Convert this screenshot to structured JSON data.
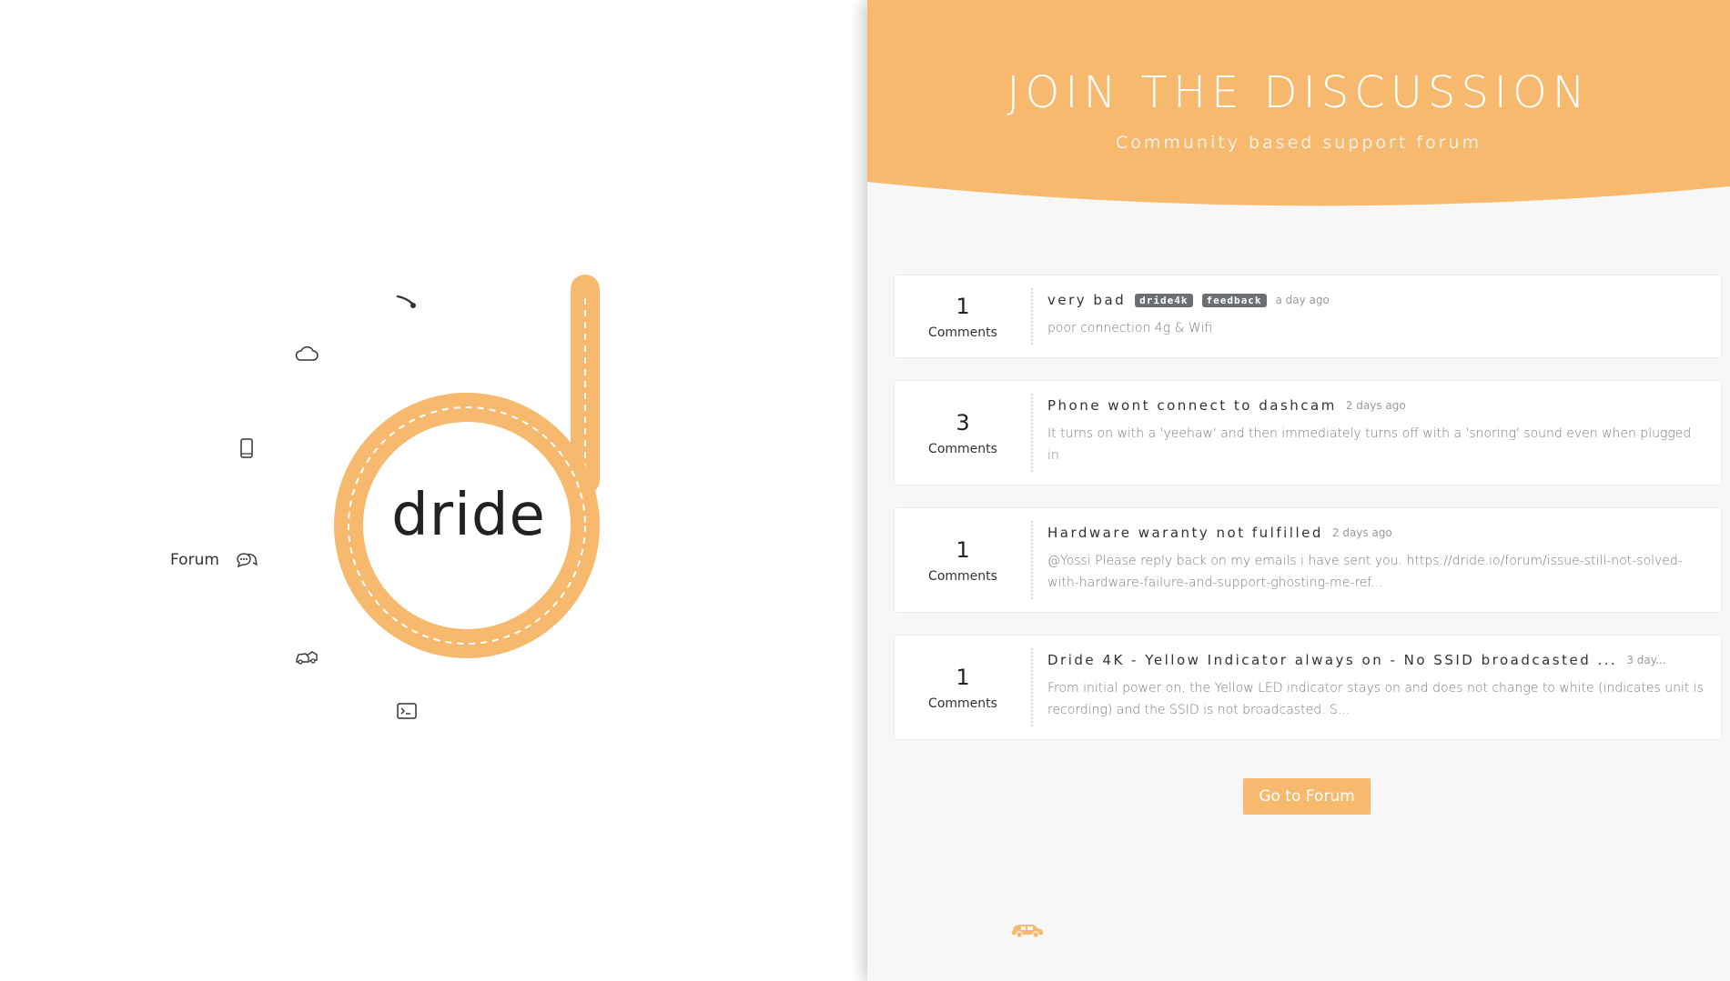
{
  "brand": {
    "name": "dride",
    "color": "#f6b96d"
  },
  "nav": {
    "items": [
      {
        "name": "dashcam-icon",
        "label": ""
      },
      {
        "name": "cloud-icon",
        "label": ""
      },
      {
        "name": "phone-icon",
        "label": ""
      },
      {
        "name": "forum-icon",
        "label": "Forum"
      },
      {
        "name": "car-crash-icon",
        "label": ""
      },
      {
        "name": "terminal-icon",
        "label": ""
      }
    ]
  },
  "hero": {
    "title": "JOIN THE DISCUSSION",
    "subtitle": "Community based support forum"
  },
  "threads": [
    {
      "count": "1",
      "count_label": "Comments",
      "title": "very bad",
      "tags": [
        "dride4k",
        "feedback"
      ],
      "time": "a day ago",
      "excerpt": "poor connection 4g & Wifi"
    },
    {
      "count": "3",
      "count_label": "Comments",
      "title": "Phone wont connect to dashcam",
      "tags": [],
      "time": "2 days ago",
      "excerpt": "It turns on with a 'yeehaw' and then immediately turns off with a 'snoring' sound even when plugged in"
    },
    {
      "count": "1",
      "count_label": "Comments",
      "title": "Hardware waranty not fulfilled",
      "tags": [],
      "time": "2 days ago",
      "excerpt": "@Yossi Please reply back on my emails i have sent you. https://dride.io/forum/issue-still-not-solved-with-hardware-failure-and-support-ghosting-me-ref..."
    },
    {
      "count": "1",
      "count_label": "Comments",
      "title": "Dride 4K - Yellow Indicator always on - No SSID broadcasted ...",
      "tags": [],
      "time": "3 day...",
      "excerpt": "From initial power on, the Yellow LED indicator stays on and does not change to white (indicates unit is recording) and the SSID is not broadcasted. S..."
    }
  ],
  "cta": {
    "label": "Go to Forum"
  },
  "footer": {
    "icon": "car-icon"
  }
}
